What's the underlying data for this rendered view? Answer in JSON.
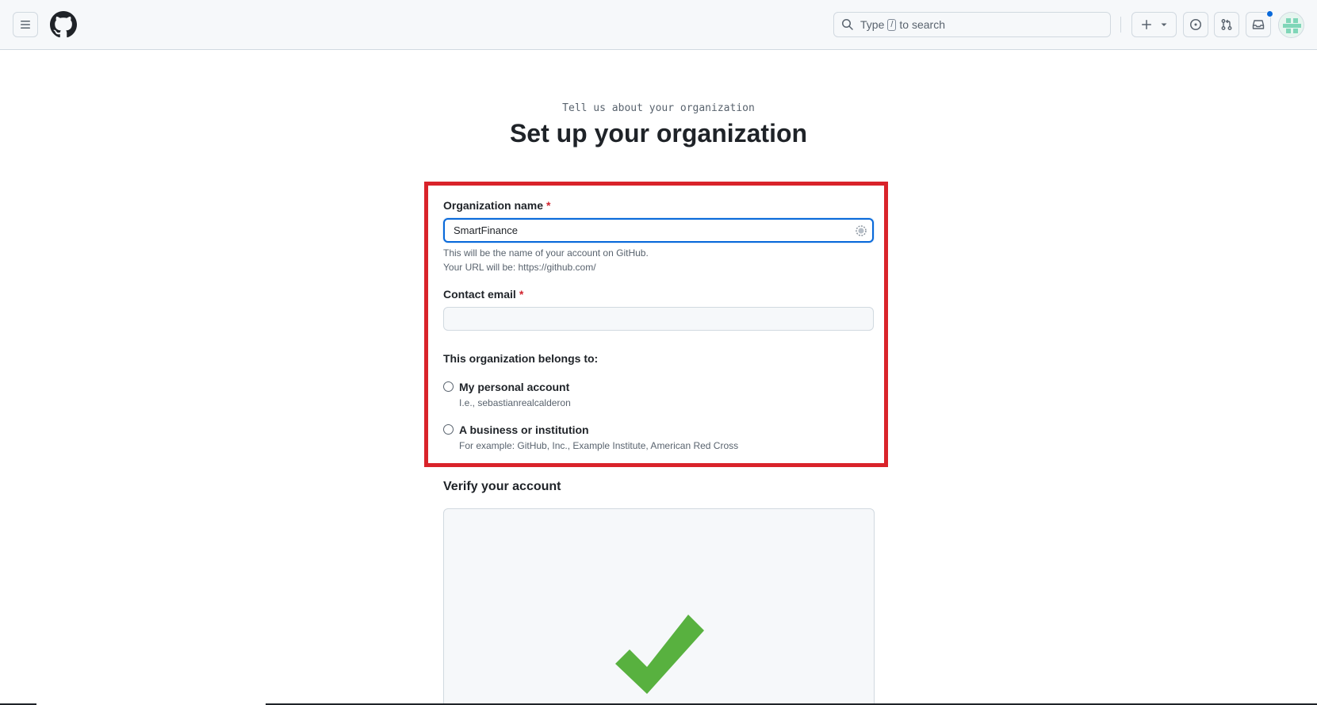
{
  "header": {
    "menu_icon": "hamburger-icon",
    "logo_icon": "github-logo-icon",
    "search": {
      "prefix": "Type",
      "key": "/",
      "suffix": "to search"
    },
    "create_icon": "plus-icon",
    "issues_icon": "issue-opened-icon",
    "pulls_icon": "git-pull-request-icon",
    "inbox_icon": "inbox-icon"
  },
  "page": {
    "subtitle": "Tell us about your organization",
    "title": "Set up your organization"
  },
  "form": {
    "org_name": {
      "label": "Organization name",
      "required_mark": "*",
      "value": "SmartFinance",
      "hint1": "This will be the name of your account on GitHub.",
      "hint2": "Your URL will be: https://github.com/"
    },
    "email": {
      "label": "Contact email",
      "required_mark": "*",
      "value": ""
    },
    "belongs": {
      "label": "This organization belongs to:",
      "options": [
        {
          "label": "My personal account",
          "hint": "I.e., sebastianrealcalderon"
        },
        {
          "label": "A business or institution",
          "hint": "For example: GitHub, Inc., Example Institute, American Red Cross"
        }
      ]
    },
    "verify": {
      "label": "Verify your account"
    }
  },
  "colors": {
    "highlight": "#d9232a",
    "accent": "#0969da",
    "check": "#58b13f"
  }
}
